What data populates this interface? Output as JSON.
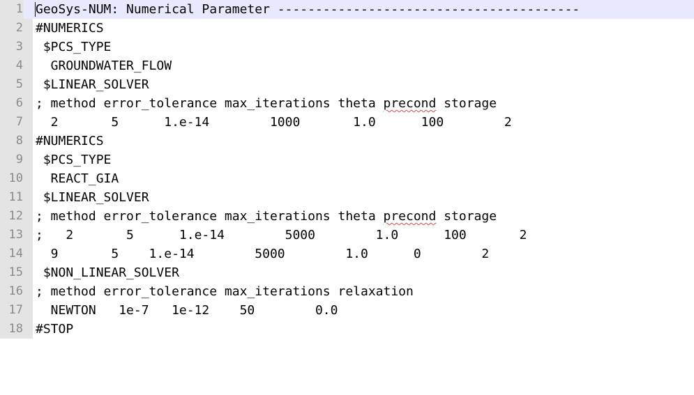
{
  "editor": {
    "lines": [
      {
        "num": "1",
        "text": "GeoSys-NUM: Numerical Parameter ----------------------------------------"
      },
      {
        "num": "2",
        "text": "#NUMERICS"
      },
      {
        "num": "3",
        "text": " $PCS_TYPE"
      },
      {
        "num": "4",
        "text": "  GROUNDWATER_FLOW"
      },
      {
        "num": "5",
        "text": " $LINEAR_SOLVER"
      },
      {
        "num": "6",
        "pre": "; method error_tolerance max_iterations theta ",
        "spell": "precond",
        "post": " storage"
      },
      {
        "num": "7",
        "text": "  2       5      1.e-14        1000       1.0      100        2"
      },
      {
        "num": "8",
        "text": "#NUMERICS"
      },
      {
        "num": "9",
        "text": " $PCS_TYPE"
      },
      {
        "num": "10",
        "text": "  REACT_GIA"
      },
      {
        "num": "11",
        "text": " $LINEAR_SOLVER"
      },
      {
        "num": "12",
        "pre": "; method error_tolerance max_iterations theta ",
        "spell": "precond",
        "post": " storage"
      },
      {
        "num": "13",
        "text": ";   2       5      1.e-14        5000        1.0      100       2"
      },
      {
        "num": "14",
        "text": "  9       5    1.e-14        5000        1.0      0        2"
      },
      {
        "num": "15",
        "text": " $NON_LINEAR_SOLVER"
      },
      {
        "num": "16",
        "text": "; method error_tolerance max_iterations relaxation"
      },
      {
        "num": "17",
        "text": "  NEWTON   1e-7   1e-12    50        0.0"
      },
      {
        "num": "18",
        "text": "#STOP"
      }
    ]
  }
}
